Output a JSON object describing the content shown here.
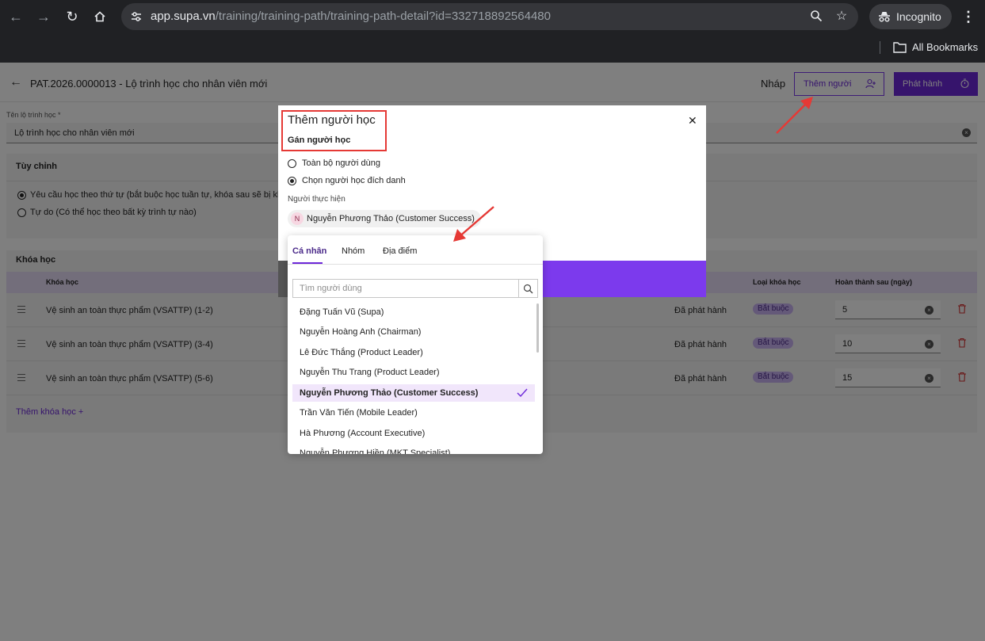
{
  "browser": {
    "url_host": "app.supa.vn",
    "url_path": "/training/training-path/training-path-detail?id=332718892564480",
    "incognito_label": "Incognito",
    "bookmarks_label": "All Bookmarks"
  },
  "header": {
    "title": "PAT.2026.0000013 - Lộ trình học cho nhân viên mới",
    "status": "Nháp",
    "add_people_label": "Thêm người",
    "publish_label": "Phát hành"
  },
  "form": {
    "name_label": "Tên lộ trình học *",
    "name_value": "Lộ trình học cho nhân viên mới"
  },
  "customize": {
    "title": "Tùy chỉnh",
    "option_sequential": "Yêu cầu học theo thứ tự (bắt buộc học tuần tự, khóa sau sẽ bị khóa",
    "option_free": "Tự do (Có thể học theo bất kỳ trình tự nào)"
  },
  "courses": {
    "title": "Khóa học",
    "columns": {
      "course": "Khóa học",
      "type": "Loại khóa học",
      "complete_after": "Hoàn thành sau (ngày)"
    },
    "rows": [
      {
        "name": "Vệ sinh an toàn thực phẩm (VSATTP) (1-2)",
        "status": "Đã phát hành",
        "type": "Bắt buộc",
        "days": "5"
      },
      {
        "name": "Vệ sinh an toàn thực phẩm (VSATTP) (3-4)",
        "status": "Đã phát hành",
        "type": "Bắt buộc",
        "days": "10"
      },
      {
        "name": "Vệ sinh an toàn thực phẩm (VSATTP) (5-6)",
        "status": "Đã phát hành",
        "type": "Bắt buộc",
        "days": "15"
      }
    ],
    "add_label": "Thêm khóa học +"
  },
  "modal": {
    "title": "Thêm người học",
    "subtitle": "Gán người học",
    "option_all": "Toàn bộ người dùng",
    "option_specific": "Chọn người học đích danh",
    "performer_label": "Người thực hiện",
    "selected_chip": "Nguyễn Phương Thảo (Customer Success)",
    "chip_initial": "N"
  },
  "dropdown": {
    "tabs": [
      "Cá nhân",
      "Nhóm",
      "Địa điểm"
    ],
    "search_placeholder": "Tìm người dùng",
    "items": [
      "Đặng Tuấn Vũ (Supa)",
      "Nguyễn Hoàng Anh (Chairman)",
      "Lê Đức Thắng (Product Leader)",
      "Nguyễn Thu Trang (Product Leader)",
      "Nguyễn Phương Thảo (Customer Success)",
      "Trần Văn Tiến (Mobile Leader)",
      "Hà Phương (Account Executive)",
      "Nguyễn Phương Hiền (MKT Specialist)"
    ],
    "selected_index": 4
  },
  "colors": {
    "brand": "#6d28d9",
    "annotation": "#e53935"
  }
}
